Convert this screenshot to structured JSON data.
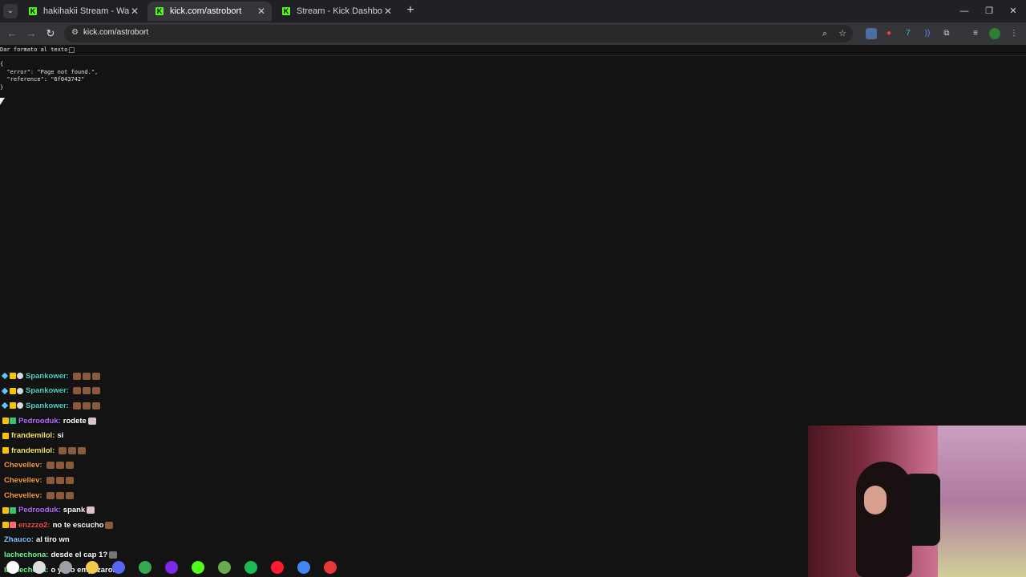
{
  "browser": {
    "tabs": [
      {
        "title": "hakihakii Stream - Watch Live o",
        "active": false
      },
      {
        "title": "kick.com/astrobort",
        "active": true
      },
      {
        "title": "Stream - Kick Dashboard",
        "active": false
      }
    ],
    "favicon_letter": "K",
    "url": "kick.com/astrobort"
  },
  "page": {
    "pretty_print_label": "Dar formato al texto",
    "json_text": "{\n  \"error\": \"Page not found.\",\n  \"reference\": \"6f043742\"\n}"
  },
  "chat": [
    {
      "user": "Spankower:",
      "color": "#4fd1c5",
      "text": "",
      "badges": [
        "sword",
        "crown",
        "helmet"
      ],
      "emotes": 3,
      "emote_style": "brown"
    },
    {
      "user": "Spankower:",
      "color": "#4fd1c5",
      "text": "",
      "badges": [
        "sword",
        "crown",
        "helmet"
      ],
      "emotes": 3,
      "emote_style": "brown"
    },
    {
      "user": "Spankower:",
      "color": "#4fd1c5",
      "text": "",
      "badges": [
        "sword",
        "crown",
        "helmet"
      ],
      "emotes": 3,
      "emote_style": "brown"
    },
    {
      "user": "Pedrooduk:",
      "color": "#b86bff",
      "text": "rodete",
      "badges": [
        "crown",
        "grid"
      ],
      "emotes": 1,
      "emote_style": "pink"
    },
    {
      "user": "frandemilol:",
      "color": "#f5e663",
      "text": "si",
      "badges": [
        "crown"
      ],
      "emotes": 0,
      "emote_style": "brown"
    },
    {
      "user": "frandemilol:",
      "color": "#f5e663",
      "text": "",
      "badges": [
        "crown"
      ],
      "emotes": 3,
      "emote_style": "brown"
    },
    {
      "user": "Chevellev:",
      "color": "#ff9a3c",
      "text": "",
      "badges": [],
      "emotes": 3,
      "emote_style": "brown"
    },
    {
      "user": "Chevellev:",
      "color": "#ff9a3c",
      "text": "",
      "badges": [],
      "emotes": 3,
      "emote_style": "brown"
    },
    {
      "user": "Chevellev:",
      "color": "#ff9a3c",
      "text": "",
      "badges": [],
      "emotes": 3,
      "emote_style": "brown"
    },
    {
      "user": "Pedrooduk:",
      "color": "#b86bff",
      "text": "spank",
      "badges": [
        "crown",
        "grid"
      ],
      "emotes": 1,
      "emote_style": "pink"
    },
    {
      "user": "enzzzo2:",
      "color": "#ff4d4d",
      "text": "no te escucho",
      "badges": [
        "crown",
        "fire"
      ],
      "emotes": 1,
      "emote_style": "brown"
    },
    {
      "user": "Zhauco:",
      "color": "#7fc8ff",
      "text": "al tiro wn",
      "badges": [],
      "emotes": 0,
      "emote_style": "brown"
    },
    {
      "user": "lachechona:",
      "color": "#6bff8f",
      "text": "desde el cap 1?",
      "badges": [],
      "emotes": 1,
      "emote_style": "gray"
    },
    {
      "user": "lachechona:",
      "color": "#6bff8f",
      "text": "o ya lo empezaron?",
      "badges": [],
      "emotes": 0,
      "emote_style": "brown"
    }
  ],
  "taskbar": {
    "icons": [
      "windows-icon",
      "search-icon",
      "taskview-icon",
      "files-icon",
      "discord-icon",
      "chrome-icon",
      "canva-icon",
      "kick-icon",
      "minecraft-icon",
      "spotify-icon",
      "opera-icon",
      "chrome-profile-icon",
      "vlc-app-icon"
    ],
    "colors": [
      "#ffffff",
      "#dddddd",
      "#9aa0a6",
      "#f2c94c",
      "#5865f2",
      "#34a853",
      "#7d2ae8",
      "#53fc18",
      "#6aa84f",
      "#1db954",
      "#ff1b2d",
      "#4285f4",
      "#e53935"
    ]
  }
}
